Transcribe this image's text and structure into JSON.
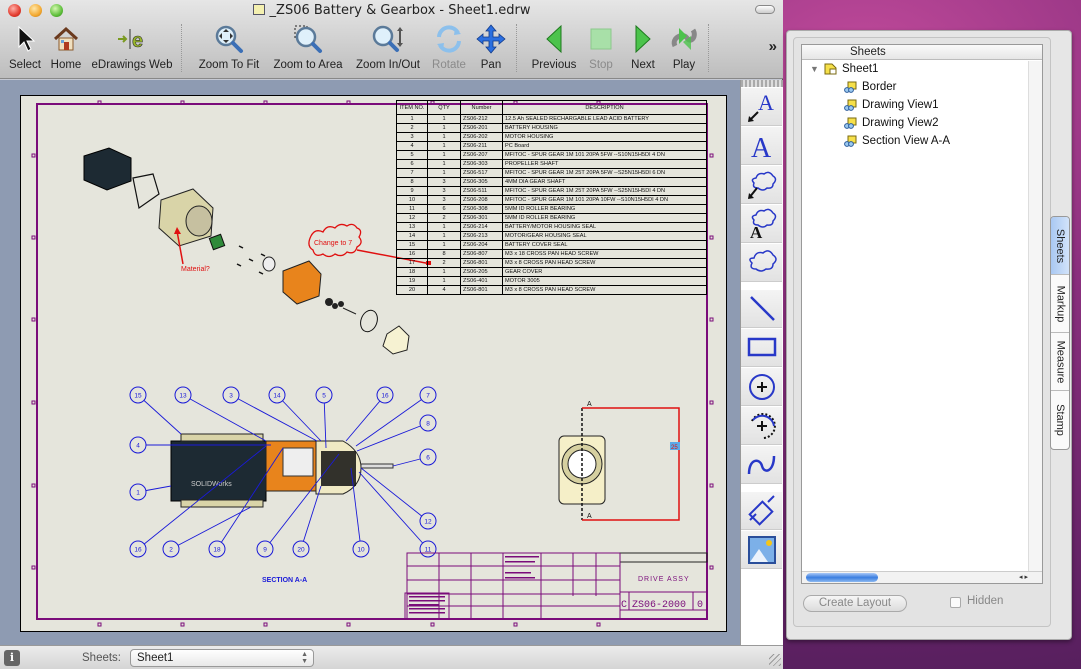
{
  "window": {
    "title": "_ZS06 Battery & Gearbox - Sheet1.edrw"
  },
  "toolbar": {
    "items": [
      {
        "id": "select",
        "label": "Select",
        "icon": "arrow-cursor-icon",
        "enabled": true
      },
      {
        "id": "home",
        "label": "Home",
        "icon": "home-icon",
        "enabled": true
      },
      {
        "id": "edrawings-web",
        "label": "eDrawings Web",
        "icon": "edrawings-web-icon",
        "enabled": true
      },
      {
        "id": "zoom-to-fit",
        "label": "Zoom To Fit",
        "icon": "zoom-to-fit-icon",
        "enabled": true
      },
      {
        "id": "zoom-to-area",
        "label": "Zoom to Area",
        "icon": "zoom-to-area-icon",
        "enabled": true
      },
      {
        "id": "zoom-in-out",
        "label": "Zoom In/Out",
        "icon": "zoom-in-out-icon",
        "enabled": true
      },
      {
        "id": "rotate",
        "label": "Rotate",
        "icon": "rotate-icon",
        "enabled": false
      },
      {
        "id": "pan",
        "label": "Pan",
        "icon": "pan-icon",
        "enabled": true
      },
      {
        "id": "previous",
        "label": "Previous",
        "icon": "previous-icon",
        "enabled": true
      },
      {
        "id": "stop",
        "label": "Stop",
        "icon": "stop-icon",
        "enabled": false
      },
      {
        "id": "next",
        "label": "Next",
        "icon": "next-icon",
        "enabled": true
      },
      {
        "id": "play",
        "label": "Play",
        "icon": "play-icon",
        "enabled": true
      }
    ],
    "overflow": "»"
  },
  "drawing": {
    "bom": {
      "headers": [
        "ITEM NO.",
        "QTY",
        "Number",
        "DESCRIPTION"
      ],
      "rows": [
        [
          "1",
          "1",
          "ZS06-212",
          "12.5 Ah SEALED RECHARGABLE LEAD ACID BATTERY"
        ],
        [
          "2",
          "1",
          "ZS06-201",
          "BATTERY HOUSING"
        ],
        [
          "3",
          "1",
          "ZS06-202",
          "MOTOR HOUSING"
        ],
        [
          "4",
          "1",
          "ZS06-211",
          "PC Board"
        ],
        [
          "5",
          "1",
          "ZS06-207",
          "MFITOC - SPUR GEAR 1M 101 20PA 5FW --S10N15H5DI 4 DN"
        ],
        [
          "6",
          "1",
          "ZS06-303",
          "PROPELLER SHAFT"
        ],
        [
          "7",
          "1",
          "ZS06-517",
          "MFITOC - SPUR GEAR 1M 25T 20PA 5FW --S25N15H5DI 6 DN"
        ],
        [
          "8",
          "3",
          "ZS06-305",
          "4MM DIA GEAR SHAFT"
        ],
        [
          "9",
          "3",
          "ZS06-511",
          "MFITOC - SPUR GEAR 1M 25T 20PA 5FW --S25N15H5DI 4 DN"
        ],
        [
          "10",
          "3",
          "ZS06-208",
          "MFITOC - SPUR GEAR 1M 101 20PA 10FW --S10N15H5DI 4 DN"
        ],
        [
          "11",
          "6",
          "ZS06-308",
          "5MM ID ROLLER BEARING"
        ],
        [
          "12",
          "2",
          "ZS06-301",
          "5MM ID ROLLER BEARING"
        ],
        [
          "13",
          "1",
          "ZS06-214",
          "BATTERY/MOTOR HOUSING SEAL"
        ],
        [
          "14",
          "1",
          "ZS06-213",
          "MOTOR/GEAR HOUSING SEAL"
        ],
        [
          "15",
          "1",
          "ZS06-204",
          "BATTERY COVER SEAL"
        ],
        [
          "16",
          "8",
          "ZS06-807",
          "M3 x 18 CROSS PAN HEAD SCREW"
        ],
        [
          "17",
          "2",
          "ZS06-801",
          "M3 x 8 CROSS PAN HEAD SCREW"
        ],
        [
          "18",
          "1",
          "ZS06-205",
          "GEAR COVER"
        ],
        [
          "19",
          "1",
          "ZS06-401",
          "MOTOR 3005"
        ],
        [
          "20",
          "4",
          "ZS06-801",
          "M3 x 8 CROSS PAN HEAD SCREW"
        ]
      ]
    },
    "markups": {
      "cloud_note": "Change to 7",
      "arrow_note": "Material?"
    },
    "balloons": [
      "15",
      "13",
      "3",
      "14",
      "5",
      "16",
      "7",
      "8",
      "6",
      "4",
      "1",
      "16",
      "2",
      "18",
      "9",
      "20",
      "10",
      "12",
      "11"
    ],
    "section_label": "SECTION A-A",
    "section_marker": "A",
    "dimension": "25",
    "title_block": {
      "title": "DRIVE ASSY",
      "drawing_number": "ZS06-2000",
      "size": "C",
      "rev": "0"
    }
  },
  "markup_tools": [
    "text-with-leader-icon",
    "text-icon",
    "cloud-with-leader-icon",
    "cloud-with-text-icon",
    "cloud-icon",
    "line-icon",
    "rectangle-icon",
    "circle-icon",
    "arc-icon",
    "spline-icon",
    "dimension-icon",
    "picture-icon"
  ],
  "statusbar": {
    "sheets_label": "Sheets:",
    "sheets_value": "Sheet1"
  },
  "panel": {
    "tree_header": "Sheets",
    "tree": [
      {
        "label": "Sheet1",
        "level": 0,
        "expanded": true,
        "icon": "sheet-icon"
      },
      {
        "label": "Border",
        "level": 1,
        "icon": "drawing-view-icon"
      },
      {
        "label": "Drawing View1",
        "level": 1,
        "icon": "drawing-view-icon"
      },
      {
        "label": "Drawing View2",
        "level": 1,
        "icon": "drawing-view-icon"
      },
      {
        "label": "Section View A-A",
        "level": 1,
        "icon": "drawing-view-icon"
      }
    ],
    "create_layout_label": "Create Layout",
    "hidden_label": "Hidden",
    "hidden_checked": false,
    "tabs": [
      {
        "label": "Sheets",
        "active": true
      },
      {
        "label": "Markup",
        "active": false
      },
      {
        "label": "Measure",
        "active": false
      },
      {
        "label": "Stamp",
        "active": false
      }
    ]
  }
}
